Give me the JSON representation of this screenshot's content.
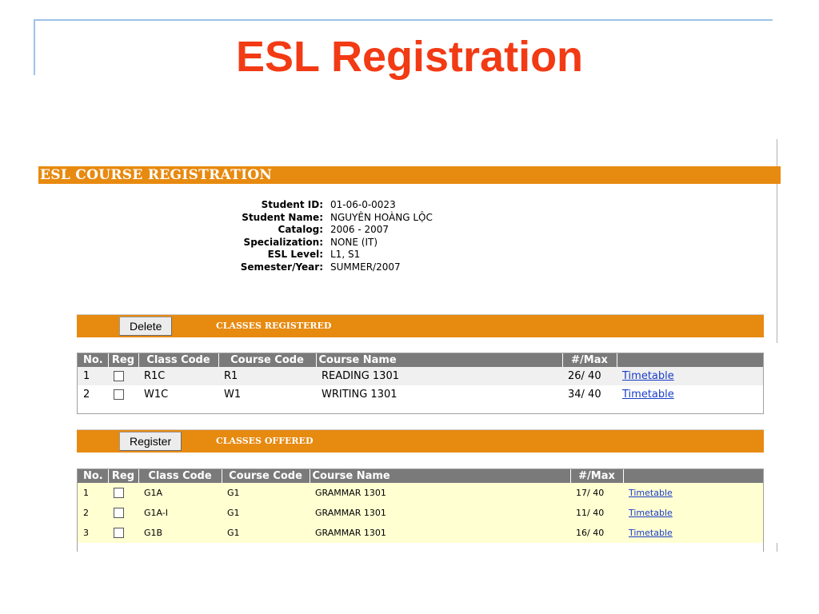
{
  "slide": {
    "title": "ESL Registration"
  },
  "app": {
    "banner": "ESL COURSE REGISTRATION",
    "student": [
      {
        "label": "Student ID:",
        "value": "01-06-0-0023"
      },
      {
        "label": "Student Name:",
        "value": "NGUYÊN HOÀNG LỘC"
      },
      {
        "label": "Catalog:",
        "value": "2006 - 2007"
      },
      {
        "label": "Specialization:",
        "value": "NONE (IT)"
      },
      {
        "label": "ESL Level:",
        "value": "L1, S1"
      },
      {
        "label": "Semester/Year:",
        "value": "SUMMER/2007"
      }
    ],
    "registered": {
      "button": "Delete",
      "title": "CLASSES REGISTERED",
      "headers": [
        "No.",
        "Reg",
        "Class Code",
        "Course Code",
        "Course Name",
        "#/Max",
        ""
      ],
      "rows": [
        {
          "no": "1",
          "class_code": "R1C",
          "course_code": "R1",
          "course_name": "READING 1301",
          "count": "26/ 40",
          "link": "Timetable"
        },
        {
          "no": "2",
          "class_code": "W1C",
          "course_code": "W1",
          "course_name": "WRITING 1301",
          "count": "34/ 40",
          "link": "Timetable"
        }
      ]
    },
    "offered": {
      "button": "Register",
      "title": "CLASSES OFFERED",
      "headers": [
        "No.",
        "Reg",
        "Class Code",
        "Course Code",
        "Course Name",
        "#/Max",
        ""
      ],
      "rows": [
        {
          "no": "1",
          "class_code": "G1A",
          "course_code": "G1",
          "course_name": "GRAMMAR 1301",
          "count": "17/ 40",
          "link": "Timetable"
        },
        {
          "no": "2",
          "class_code": "G1A-I",
          "course_code": "G1",
          "course_name": "GRAMMAR 1301",
          "count": "11/ 40",
          "link": "Timetable"
        },
        {
          "no": "3",
          "class_code": "G1B",
          "course_code": "G1",
          "course_name": "GRAMMAR 1301",
          "count": "16/ 40",
          "link": "Timetable"
        }
      ]
    }
  },
  "colors": {
    "title": "#f23a14",
    "banner": "#e78a10",
    "header": "#7a7a7a",
    "offered_row": "#ffffd2",
    "link": "#1a3cc8"
  }
}
